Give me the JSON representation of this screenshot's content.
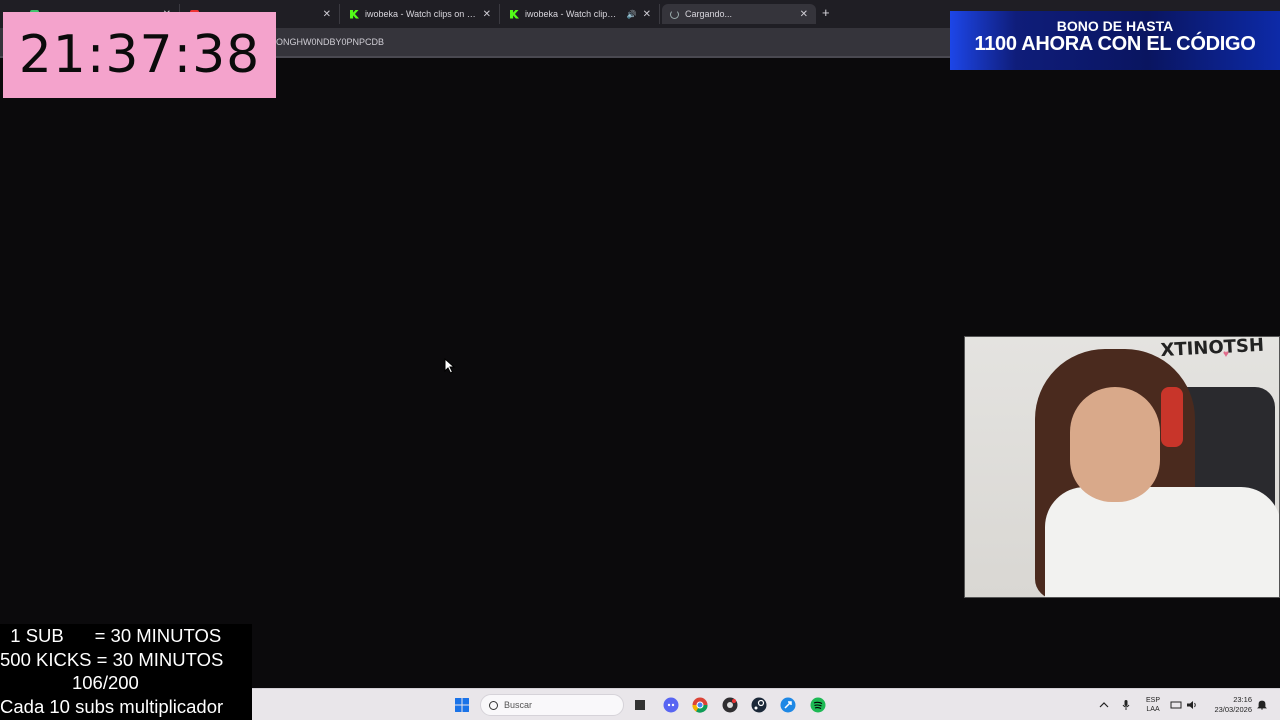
{
  "browser": {
    "tabs": [
      {
        "title": "",
        "favicon": "green-icon"
      },
      {
        "title": "",
        "favicon": "red-icon"
      },
      {
        "title": "iwobeka - Watch clips on Kick",
        "favicon": "kick-icon"
      },
      {
        "title": "iwobeka - Watch clips on K",
        "favicon": "kick-icon",
        "audio": "🔊"
      },
      {
        "title": "Cargando...",
        "favicon": "loading-icon"
      }
    ],
    "close_glyph": "✕",
    "new_tab_glyph": "+",
    "url_fragment": "ONGHW0NDBY0PNPCDB"
  },
  "overlay": {
    "timer": "21:37:38",
    "bonus_line1": "BONO DE HASTA",
    "bonus_line2": "1100 AHORA CON EL CÓDIGO",
    "webcam_sign": "XTINOTSH",
    "subs": {
      "line1": "  1 SUB      = 30 MINUTOS",
      "line2": "500 KICKS = 30 MINUTOS",
      "line3": "              106/200",
      "line4": "Cada 10 subs multiplicador"
    }
  },
  "taskbar": {
    "search_placeholder": "Buscar",
    "lang_line1": "ESP",
    "lang_line2": "LAA",
    "time": "23:16",
    "date": "23/03/2026",
    "pinned": [
      "windows-start-icon",
      "task-view-icon",
      "discord-icon",
      "chrome-icon",
      "obs-icon",
      "steam-icon",
      "app-icon",
      "spotify-icon"
    ]
  },
  "colors": {
    "timer_bg": "#f4a3cc",
    "page_bg": "#0b0a0c",
    "taskbar_bg": "#e9e6ea",
    "kick_green": "#53fc18"
  }
}
